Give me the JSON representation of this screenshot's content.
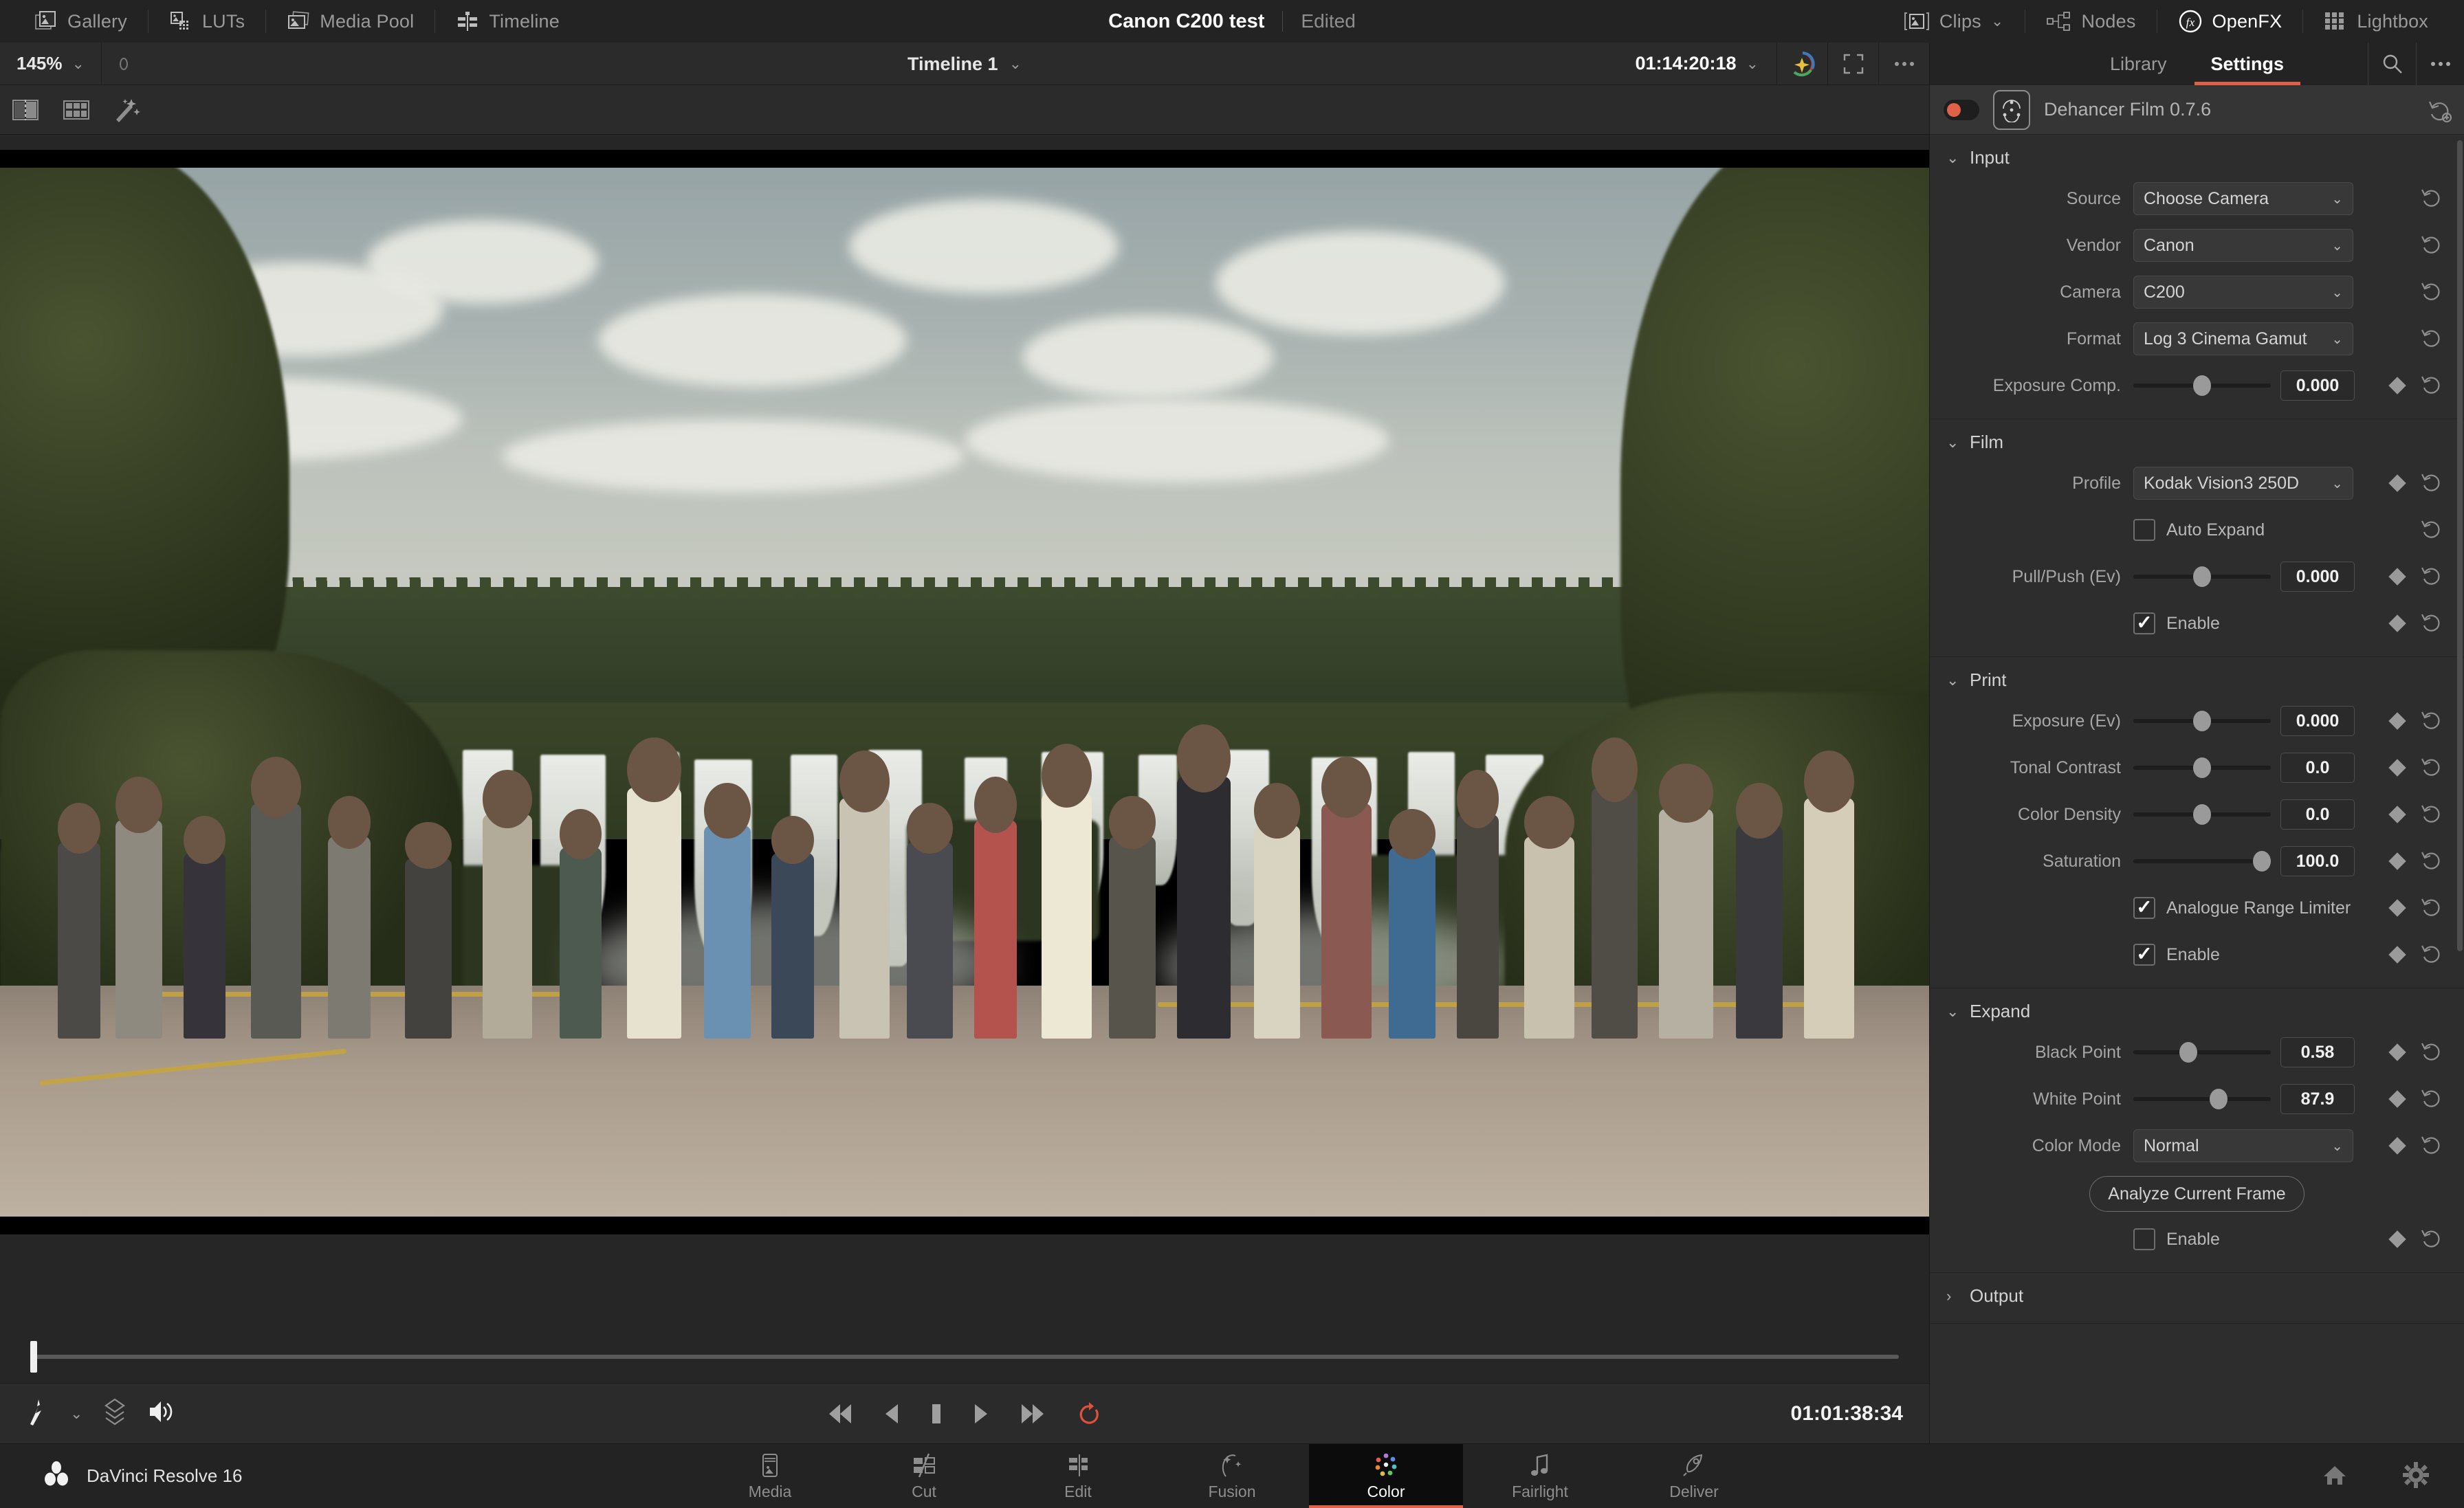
{
  "topbar": {
    "left_items": [
      {
        "label": "Gallery",
        "icon": "gallery-icon"
      },
      {
        "label": "LUTs",
        "icon": "luts-icon"
      },
      {
        "label": "Media Pool",
        "icon": "media-pool-icon"
      },
      {
        "label": "Timeline",
        "icon": "timeline-icon"
      }
    ],
    "project_name": "Canon C200 test",
    "project_state": "Edited",
    "right_items": [
      {
        "label": "Clips",
        "icon": "clips-icon",
        "active": false,
        "has_chevron": true
      },
      {
        "label": "Nodes",
        "icon": "nodes-icon",
        "active": false,
        "has_chevron": false
      },
      {
        "label": "OpenFX",
        "icon": "openfx-icon",
        "active": true,
        "has_chevron": false
      },
      {
        "label": "Lightbox",
        "icon": "lightbox-icon",
        "active": false,
        "has_chevron": false
      }
    ]
  },
  "viewer": {
    "zoom_level": "145%",
    "timeline_name": "Timeline 1",
    "source_timecode": "01:14:20:18",
    "playhead_timecode": "01:01:38:34",
    "subbar_icons": [
      "split-screen-icon",
      "grid-view-icon",
      "enhance-wand-icon"
    ],
    "topbar_icons": [
      "color-wheel-icon",
      "fullscreen-icon",
      "more-options-icon"
    ],
    "transport_left_icons": [
      "grab-still-icon",
      "chevron-down-icon",
      "stills-stack-icon",
      "audio-volume-icon"
    ],
    "transport_buttons": [
      "skip-to-start",
      "play-reverse",
      "stop",
      "play-forward",
      "skip-to-end",
      "loop"
    ]
  },
  "inspector": {
    "tabs": [
      {
        "label": "Library",
        "active": false
      },
      {
        "label": "Settings",
        "active": true
      }
    ],
    "tools": [
      "search-icon",
      "more-options-icon"
    ],
    "accent_color": "#e0614a",
    "plugin": {
      "name": "Dehancer Film 0.7.6",
      "enabled": true,
      "toggle_color": "#e0614a"
    },
    "sections": [
      {
        "id": "input",
        "title": "Input",
        "expanded": true,
        "rows": [
          {
            "type": "dropdown",
            "label": "Source",
            "value": "Choose Camera",
            "keyframe": false,
            "reset": true
          },
          {
            "type": "dropdown",
            "label": "Vendor",
            "value": "Canon",
            "keyframe": false,
            "reset": true
          },
          {
            "type": "dropdown",
            "label": "Camera",
            "value": "C200",
            "keyframe": false,
            "reset": true
          },
          {
            "type": "dropdown",
            "label": "Format",
            "value": "Log 3 Cinema Gamut",
            "keyframe": false,
            "reset": true
          },
          {
            "type": "slider",
            "label": "Exposure Comp.",
            "value": "0.000",
            "knob_pct": 50,
            "keyframe": true,
            "reset": true
          }
        ]
      },
      {
        "id": "film",
        "title": "Film",
        "expanded": true,
        "rows": [
          {
            "type": "dropdown",
            "label": "Profile",
            "value": "Kodak Vision3 250D",
            "keyframe": true,
            "reset": true
          },
          {
            "type": "checkbox",
            "label": "Auto Expand",
            "checked": false,
            "keyframe": false,
            "reset": true
          },
          {
            "type": "slider",
            "label": "Pull/Push (Ev)",
            "value": "0.000",
            "knob_pct": 50,
            "keyframe": true,
            "reset": true
          },
          {
            "type": "checkbox",
            "label": "Enable",
            "checked": true,
            "keyframe": true,
            "reset": true
          }
        ]
      },
      {
        "id": "print",
        "title": "Print",
        "expanded": true,
        "rows": [
          {
            "type": "slider",
            "label": "Exposure (Ev)",
            "value": "0.000",
            "knob_pct": 50,
            "keyframe": true,
            "reset": true
          },
          {
            "type": "slider",
            "label": "Tonal Contrast",
            "value": "0.0",
            "knob_pct": 50,
            "keyframe": true,
            "reset": true
          },
          {
            "type": "slider",
            "label": "Color Density",
            "value": "0.0",
            "knob_pct": 50,
            "keyframe": true,
            "reset": true
          },
          {
            "type": "slider",
            "label": "Saturation",
            "value": "100.0",
            "knob_pct": 97,
            "keyframe": true,
            "reset": true
          },
          {
            "type": "checkbox",
            "label": "Analogue Range Limiter",
            "checked": true,
            "keyframe": true,
            "reset": true
          },
          {
            "type": "checkbox",
            "label": "Enable",
            "checked": true,
            "keyframe": true,
            "reset": true
          }
        ]
      },
      {
        "id": "expand",
        "title": "Expand",
        "expanded": true,
        "rows": [
          {
            "type": "slider",
            "label": "Black Point",
            "value": "0.58",
            "knob_pct": 40,
            "keyframe": true,
            "reset": true
          },
          {
            "type": "slider",
            "label": "White Point",
            "value": "87.9",
            "knob_pct": 62,
            "keyframe": true,
            "reset": true
          },
          {
            "type": "dropdown",
            "label": "Color Mode",
            "value": "Normal",
            "keyframe": true,
            "reset": true
          },
          {
            "type": "button",
            "label": "Analyze Current Frame"
          },
          {
            "type": "checkbox",
            "label": "Enable",
            "checked": false,
            "keyframe": true,
            "reset": true
          }
        ]
      },
      {
        "id": "output",
        "title": "Output",
        "expanded": false,
        "rows": []
      }
    ]
  },
  "bottombar": {
    "app_name": "DaVinci Resolve 16",
    "logo": "resolve-logo-icon",
    "pages": [
      {
        "label": "Media",
        "icon": "media-page-icon",
        "active": false
      },
      {
        "label": "Cut",
        "icon": "cut-page-icon",
        "active": false
      },
      {
        "label": "Edit",
        "icon": "edit-page-icon",
        "active": false
      },
      {
        "label": "Fusion",
        "icon": "fusion-page-icon",
        "active": false
      },
      {
        "label": "Color",
        "icon": "color-page-icon",
        "active": true
      },
      {
        "label": "Fairlight",
        "icon": "fairlight-page-icon",
        "active": false
      },
      {
        "label": "Deliver",
        "icon": "deliver-page-icon",
        "active": false
      }
    ],
    "right_icons": [
      "home-icon",
      "gear-icon"
    ]
  }
}
